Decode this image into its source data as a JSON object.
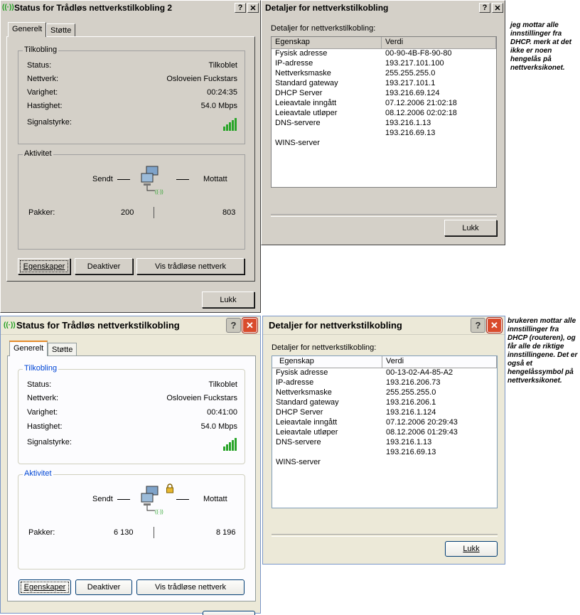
{
  "status": {
    "title": "Status for Trådløs nettverkstilkobling 2",
    "title_xp": "Status for Trådløs nettverkstilkobling",
    "tabs": [
      "Generelt",
      "Støtte"
    ],
    "connection_group": "Tilkobling",
    "labels": {
      "status": "Status:",
      "network": "Nettverk:",
      "duration": "Varighet:",
      "speed": "Hastighet:",
      "signal": "Signalstyrke:"
    },
    "top": {
      "status": "Tilkoblet",
      "network": "Osloveien Fuckstars",
      "duration": "00:24:35",
      "speed": "54.0 Mbps",
      "sent": "200",
      "received": "803"
    },
    "bottom": {
      "status": "Tilkoblet",
      "network": "Osloveien Fuckstars",
      "duration": "00:41:00",
      "speed": "54.0 Mbps",
      "sent": "6 130",
      "received": "8 196"
    },
    "activity_group": "Aktivitet",
    "sent_label": "Sendt",
    "received_label": "Mottatt",
    "packets_label": "Pakker:",
    "buttons": {
      "properties": "Egenskaper",
      "disable": "Deaktiver",
      "wireless": "Vis trådløse nettverk",
      "close": "Lukk"
    }
  },
  "details": {
    "title": "Detaljer for nettverkstilkobling",
    "caption": "Detaljer for nettverkstilkobling:",
    "col_property": "Egenskap",
    "col_value": "Verdi",
    "top_rows": [
      {
        "k": "Fysisk adresse",
        "v": "00-90-4B-F8-90-80"
      },
      {
        "k": "IP-adresse",
        "v": "193.217.101.100"
      },
      {
        "k": "Nettverksmaske",
        "v": "255.255.255.0"
      },
      {
        "k": "Standard gateway",
        "v": "193.217.101.1"
      },
      {
        "k": "DHCP Server",
        "v": "193.216.69.124"
      },
      {
        "k": "Leieavtale inngått",
        "v": "07.12.2006 21:02:18"
      },
      {
        "k": "Leieavtale utløper",
        "v": "08.12.2006 02:02:18"
      },
      {
        "k": "DNS-servere",
        "v": "193.216.1.13"
      },
      {
        "k": "",
        "v": "193.216.69.13"
      },
      {
        "k": "WINS-server",
        "v": ""
      }
    ],
    "bottom_rows": [
      {
        "k": "Fysisk adresse",
        "v": "00-13-02-A4-85-A2"
      },
      {
        "k": "IP-adresse",
        "v": "193.216.206.73"
      },
      {
        "k": "Nettverksmaske",
        "v": "255.255.255.0"
      },
      {
        "k": "Standard gateway",
        "v": "193.216.206.1"
      },
      {
        "k": "DHCP Server",
        "v": "193.216.1.124"
      },
      {
        "k": "Leieavtale inngått",
        "v": "07.12.2006 20:29:43"
      },
      {
        "k": "Leieavtale utløper",
        "v": "08.12.2006 01:29:43"
      },
      {
        "k": "DNS-servere",
        "v": "193.216.1.13"
      },
      {
        "k": "",
        "v": "193.216.69.13"
      },
      {
        "k": "WINS-server",
        "v": ""
      }
    ],
    "close": "Lukk"
  },
  "notes": {
    "top": "jeg mottar alle innstillinger fra DHCP. merk at det ikke er noen hengelås på nettverksikonet.",
    "bottom": "brukeren mottar alle innstillinger fra DHCP (routeren), og får alle de riktige innstillingene. Det er også et hengelåssymbol på nettverksikonet."
  },
  "colors": {
    "classic_face": "#d4d0c8",
    "xp_face": "#ece9d8",
    "xp_group_label": "#0046d5",
    "signal": "#2aa52a"
  },
  "icons": [
    "wireless-antenna-icon",
    "help-icon",
    "close-icon",
    "network-computers-icon",
    "padlock-icon",
    "signal-strength-icon"
  ]
}
